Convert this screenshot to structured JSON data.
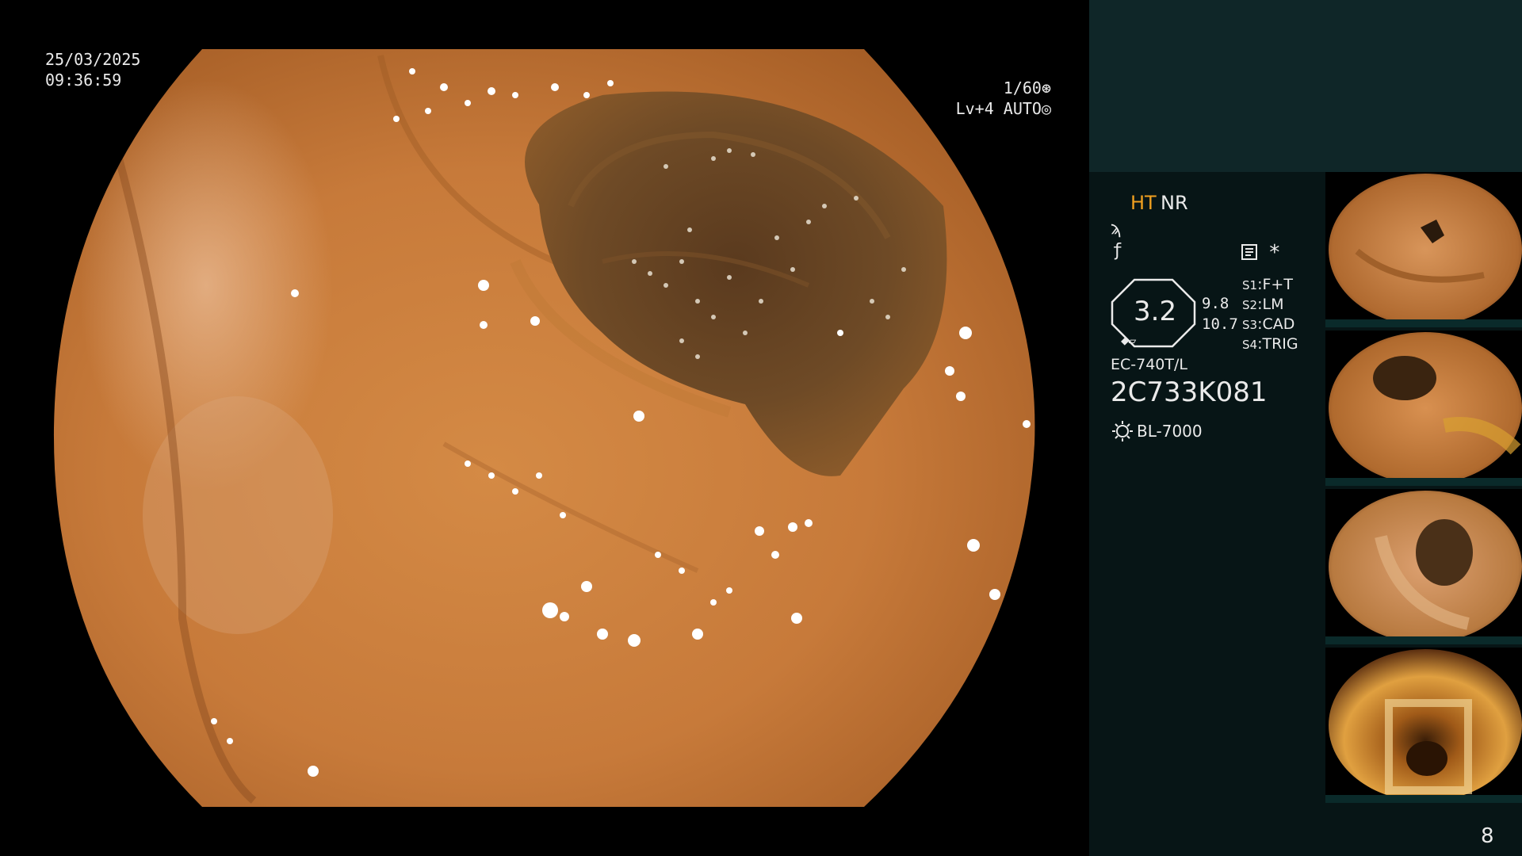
{
  "overlay": {
    "date": "25/03/2025",
    "time": "09:36:59",
    "shutter": "1/60",
    "level": "Lv+4 AUTO"
  },
  "panel": {
    "mode_ht": "HT",
    "mode_nr": "NR",
    "zoom": "3.2",
    "zoom_ratio_1": "9.8",
    "zoom_ratio_2": "10.7",
    "switches": [
      {
        "key": "S1",
        "value": "F+T"
      },
      {
        "key": "S2",
        "value": "LM"
      },
      {
        "key": "S3",
        "value": "CAD"
      },
      {
        "key": "S4",
        "value": "TRIG"
      }
    ],
    "asterisk": "*",
    "scope_model": "EC-740T/L",
    "scope_serial": "2C733K081",
    "light_source": "BL-7000"
  },
  "page_number": "8",
  "icons": [
    "shutter-icon",
    "auto-iris-icon",
    "enhance-icon",
    "color-icon",
    "memo-icon",
    "light-source-icon",
    "pencil-icon"
  ]
}
